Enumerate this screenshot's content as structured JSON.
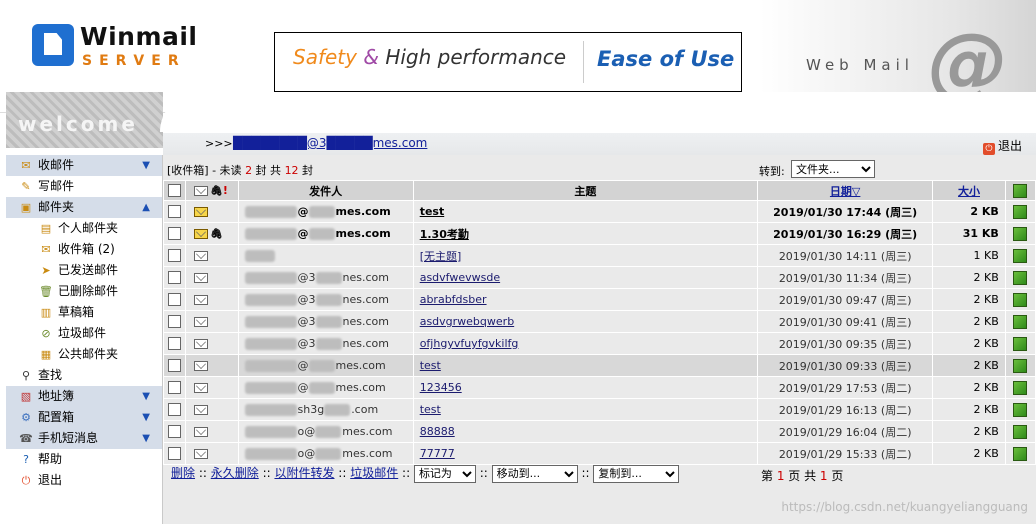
{
  "header": {
    "logo_title": "Winmail",
    "logo_sub": "SERVER",
    "banner_safety": "Safety",
    "banner_amp": "&",
    "banner_high": "High performance",
    "banner_ease": "Ease of Use",
    "webmail": "Web Mail",
    "welcome": "welcome"
  },
  "userbar": {
    "prefix": ">>>",
    "email": "████████@3█████mes.com",
    "exit_label": "退出"
  },
  "sidebar": {
    "items": [
      {
        "label": "收邮件",
        "icon": "inbox-pen-icon",
        "type": "group",
        "arrow": "▼"
      },
      {
        "label": "写邮件",
        "icon": "compose-icon",
        "type": "plain"
      },
      {
        "label": "邮件夹",
        "icon": "folders-icon",
        "type": "group",
        "arrow": "▲"
      },
      {
        "label": "个人邮件夹",
        "icon": "personal-folder-icon",
        "type": "sub"
      },
      {
        "label": "收件箱 (2)",
        "icon": "inbox-icon",
        "type": "sub"
      },
      {
        "label": "已发送邮件",
        "icon": "sent-icon",
        "type": "sub"
      },
      {
        "label": "已删除邮件",
        "icon": "trash-icon",
        "type": "sub"
      },
      {
        "label": "草稿箱",
        "icon": "drafts-icon",
        "type": "sub"
      },
      {
        "label": "垃圾邮件",
        "icon": "spam-icon",
        "type": "sub"
      },
      {
        "label": "公共邮件夹",
        "icon": "public-folder-icon",
        "type": "sub"
      },
      {
        "label": "查找",
        "icon": "search-icon",
        "type": "plain"
      },
      {
        "label": "地址簿",
        "icon": "address-book-icon",
        "type": "group",
        "arrow": "▼"
      },
      {
        "label": "配置箱",
        "icon": "settings-icon",
        "type": "group",
        "arrow": "▼"
      },
      {
        "label": "手机短消息",
        "icon": "sms-icon",
        "type": "group",
        "arrow": "▼"
      },
      {
        "label": "帮助",
        "icon": "help-icon",
        "type": "plain"
      },
      {
        "label": "退出",
        "icon": "exit-icon",
        "type": "plain"
      }
    ]
  },
  "mailbox": {
    "folder": "[收件箱]",
    "unread_prefix": " - 未读 ",
    "unread": "2",
    "mid": " 封 共 ",
    "total": "12",
    "suffix": " 封",
    "goto_label": "转到:",
    "goto_value": "文件夹..."
  },
  "columns": {
    "sender": "发件人",
    "subject": "主题",
    "date": "日期▽",
    "size": "大小"
  },
  "messages": [
    {
      "sender_visible": "@",
      "sender_tail": "mes.com",
      "subject": "test",
      "date": "2019/01/30 17:44 (周三)",
      "size": "2 KB",
      "unread": true,
      "attach": false
    },
    {
      "sender_visible": "@",
      "sender_tail": "mes.com",
      "subject": "1.30考勤",
      "date": "2019/01/30 16:29 (周三)",
      "size": "31 KB",
      "unread": true,
      "attach": true
    },
    {
      "sender_visible": "",
      "sender_tail": "",
      "subject": "[无主题]",
      "date": "2019/01/30 14:11 (周三)",
      "size": "1 KB",
      "unread": false,
      "attach": false
    },
    {
      "sender_visible": "@3",
      "sender_tail": "nes.com",
      "subject": "asdvfwevwsde",
      "date": "2019/01/30 11:34 (周三)",
      "size": "2 KB",
      "unread": false,
      "attach": false
    },
    {
      "sender_visible": "@3",
      "sender_tail": "nes.com",
      "subject": "abrabfdsber",
      "date": "2019/01/30 09:47 (周三)",
      "size": "2 KB",
      "unread": false,
      "attach": false
    },
    {
      "sender_visible": "@3",
      "sender_tail": "nes.com",
      "subject": "asdvgrwebqwerb",
      "date": "2019/01/30 09:41 (周三)",
      "size": "2 KB",
      "unread": false,
      "attach": false
    },
    {
      "sender_visible": "@3",
      "sender_tail": "nes.com",
      "subject": "ofjhgyvfuyfgvkilfg",
      "date": "2019/01/30 09:35 (周三)",
      "size": "2 KB",
      "unread": false,
      "attach": false
    },
    {
      "sender_visible": "@",
      "sender_tail": "mes.com",
      "subject": "test",
      "date": "2019/01/30 09:33 (周三)",
      "size": "2 KB",
      "unread": false,
      "attach": false,
      "highlight": true
    },
    {
      "sender_visible": "@",
      "sender_tail": "mes.com",
      "subject": "123456",
      "date": "2019/01/29 17:53 (周二)",
      "size": "2 KB",
      "unread": false,
      "attach": false
    },
    {
      "sender_visible": "sh3g",
      "sender_tail": ".com",
      "subject": "test",
      "date": "2019/01/29 16:13 (周二)",
      "size": "2 KB",
      "unread": false,
      "attach": false
    },
    {
      "sender_visible": "o@",
      "sender_tail": "mes.com",
      "subject": "88888",
      "date": "2019/01/29 16:04 (周二)",
      "size": "2 KB",
      "unread": false,
      "attach": false
    },
    {
      "sender_visible": "o@",
      "sender_tail": "mes.com",
      "subject": "77777",
      "date": "2019/01/29 15:33 (周二)",
      "size": "2 KB",
      "unread": false,
      "attach": false
    }
  ],
  "footer": {
    "delete": "删除",
    "perm_delete": "永久删除",
    "forward_attach": "以附件转发",
    "spam": "垃圾邮件",
    "mark_as": "标记为",
    "move_to": "移动到...",
    "copy_to": "复制到...",
    "page_prefix": "第 ",
    "page": "1",
    "page_mid": " 页 共 ",
    "pages": "1",
    "page_suffix": " 页"
  },
  "watermark": "https://blog.csdn.net/kuangyeliangguang"
}
